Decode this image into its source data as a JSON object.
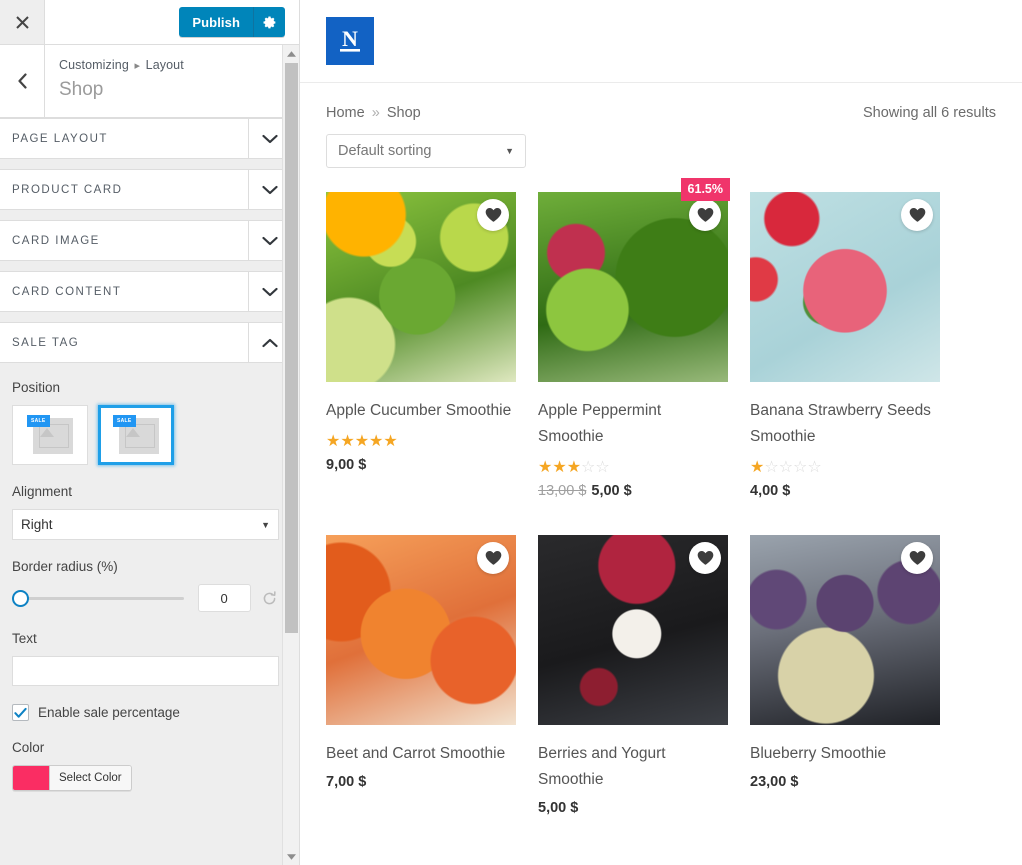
{
  "customizer": {
    "close_icon": "close-icon",
    "publish_label": "Publish",
    "gear_icon": "gear-icon",
    "back_icon": "chevron-left-icon",
    "breadcrumb_root": "Customizing",
    "breadcrumb_sep": "▸",
    "breadcrumb_current": "Layout",
    "panel_title": "Shop",
    "sections": [
      {
        "label": "Page Layout",
        "open": false,
        "chevron": "chevron-down-icon"
      },
      {
        "label": "Product Card",
        "open": false,
        "chevron": "chevron-down-icon"
      },
      {
        "label": "Card Image",
        "open": false,
        "chevron": "chevron-down-icon"
      },
      {
        "label": "Card Content",
        "open": false,
        "chevron": "chevron-down-icon"
      },
      {
        "label": "Sale Tag",
        "open": true,
        "chevron": "chevron-up-icon"
      }
    ],
    "sale_tag": {
      "position_label": "Position",
      "position_options": [
        {
          "name": "inside-image",
          "tag_text": "SALE",
          "selected": false
        },
        {
          "name": "over-image",
          "tag_text": "SALE",
          "selected": true
        }
      ],
      "alignment_label": "Alignment",
      "alignment_value": "Right",
      "border_radius_label": "Border radius (%)",
      "border_radius_value": "0",
      "reset_icon": "reset-icon",
      "text_label": "Text",
      "text_value": "",
      "enable_percentage_label": "Enable sale percentage",
      "enable_percentage_checked": true,
      "color_label": "Color",
      "color_value": "#fa2d63",
      "select_color_label": "Select Color"
    },
    "accent_blue": "#0085ba",
    "selection_blue": "#1e9fe8"
  },
  "preview": {
    "logo_letter": "N",
    "breadcrumb": {
      "home": "Home",
      "sep": "»",
      "current": "Shop"
    },
    "results_text": "Showing all 6 results",
    "sort_value": "Default sorting",
    "sale_badge_color": "#f0356b",
    "star_color": "#f5a623",
    "products": [
      {
        "title": "Apple Cucumber Smoothie",
        "img_class": "img-apple-cucumber",
        "price": "9,00 $",
        "old_price": "",
        "stars_full": 5,
        "stars_total": 5,
        "has_rating": true,
        "sale_badge": "",
        "wishlist_icon": "heart-icon"
      },
      {
        "title": "Apple Peppermint Smoothie",
        "img_class": "img-apple-peppermint",
        "price": "5,00 $",
        "old_price": "13,00 $",
        "stars_full": 3,
        "stars_total": 5,
        "has_rating": true,
        "sale_badge": "61.5%",
        "wishlist_icon": "heart-icon"
      },
      {
        "title": "Banana Strawberry Seeds Smoothie",
        "img_class": "img-banana-strawberry",
        "price": "4,00 $",
        "old_price": "",
        "stars_full": 1,
        "stars_total": 5,
        "has_rating": true,
        "sale_badge": "",
        "wishlist_icon": "heart-icon"
      },
      {
        "title": "Beet and Carrot Smoothie",
        "img_class": "img-beet-carrot",
        "price": "7,00 $",
        "old_price": "",
        "stars_full": 0,
        "stars_total": 5,
        "has_rating": false,
        "sale_badge": "",
        "wishlist_icon": "heart-icon"
      },
      {
        "title": "Berries and Yogurt Smoothie",
        "img_class": "img-berries-yogurt",
        "price": "5,00 $",
        "old_price": "",
        "stars_full": 0,
        "stars_total": 5,
        "has_rating": false,
        "sale_badge": "",
        "wishlist_icon": "heart-icon"
      },
      {
        "title": "Blueberry Smoothie",
        "img_class": "img-blueberry",
        "price": "23,00 $",
        "old_price": "",
        "stars_full": 0,
        "stars_total": 5,
        "has_rating": false,
        "sale_badge": "",
        "wishlist_icon": "heart-icon"
      }
    ]
  }
}
